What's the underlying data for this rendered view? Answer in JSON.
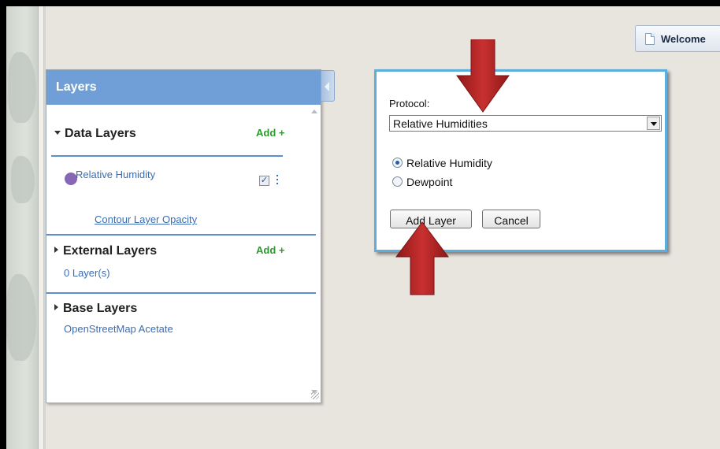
{
  "welcome_tab": {
    "label": "Welcome"
  },
  "layers_panel": {
    "title": "Layers",
    "data_layers": {
      "title": "Data Layers",
      "add_label": "Add +",
      "layer": {
        "name": "Relative Humidity",
        "checkbox_mark": "✓",
        "color": "#8867b7"
      },
      "opacity_link": "Contour Layer Opacity"
    },
    "external_layers": {
      "title": "External Layers",
      "add_label": "Add +",
      "count_label": "0 Layer(s)"
    },
    "base_layers": {
      "title": "Base Layers",
      "current": "OpenStreetMap Acetate"
    }
  },
  "add_layer_dialog": {
    "protocol_label": "Protocol:",
    "protocol_value": "Relative Humidities",
    "options": [
      {
        "label": "Relative Humidity",
        "selected": true
      },
      {
        "label": "Dewpoint",
        "selected": false
      }
    ],
    "add_button": "Add Layer",
    "cancel_button": "Cancel"
  },
  "colors": {
    "header_blue": "#6f9fd6",
    "link_blue": "#3a6db5",
    "add_green": "#2e9a2e",
    "arrow_red": "#b52222",
    "dialog_border": "#5eaedd"
  }
}
